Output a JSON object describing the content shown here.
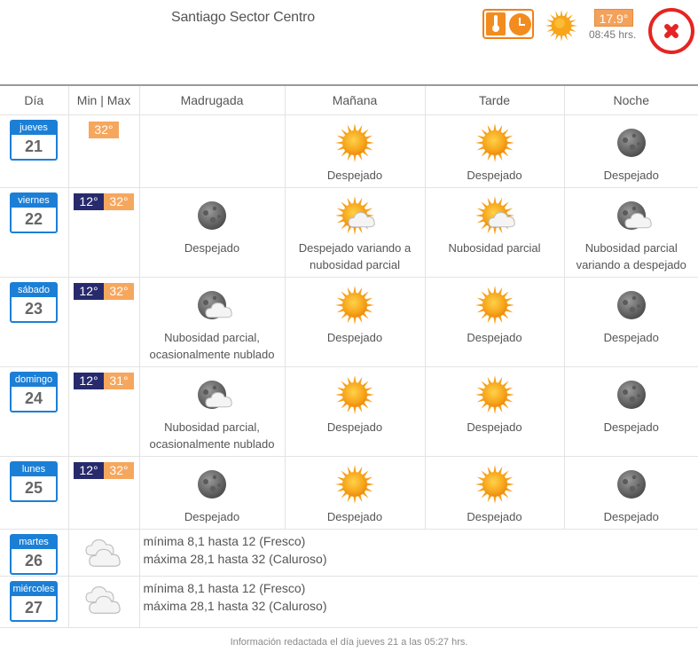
{
  "header": {
    "location": "Santiago Sector Centro",
    "current_temp": "17.9°",
    "current_time": "08:45 hrs.",
    "icons": [
      "thermometer-clock-icon",
      "sun-icon",
      "close-icon"
    ]
  },
  "columns": [
    "Día",
    "Min | Max",
    "Madrugada",
    "Mañana",
    "Tarde",
    "Noche"
  ],
  "days": [
    {
      "name": "jueves",
      "num": "21",
      "min": "",
      "max": "32°",
      "periods": [
        {
          "icon": "",
          "desc": ""
        },
        {
          "icon": "sun",
          "desc": "Despejado"
        },
        {
          "icon": "sun",
          "desc": "Despejado"
        },
        {
          "icon": "moon",
          "desc": "Despejado"
        }
      ]
    },
    {
      "name": "viernes",
      "num": "22",
      "min": "12°",
      "max": "32°",
      "periods": [
        {
          "icon": "moon",
          "desc": "Despejado"
        },
        {
          "icon": "sun-cloud",
          "desc": "Despejado variando a nubosidad parcial"
        },
        {
          "icon": "sun-cloud",
          "desc": "Nubosidad parcial"
        },
        {
          "icon": "moon-cloud",
          "desc": "Nubosidad parcial variando a despejado"
        }
      ]
    },
    {
      "name": "sábado",
      "num": "23",
      "min": "12°",
      "max": "32°",
      "periods": [
        {
          "icon": "moon-cloud",
          "desc": "Nubosidad parcial, ocasionalmente nublado"
        },
        {
          "icon": "sun",
          "desc": "Despejado"
        },
        {
          "icon": "sun",
          "desc": "Despejado"
        },
        {
          "icon": "moon",
          "desc": "Despejado"
        }
      ]
    },
    {
      "name": "domingo",
      "num": "24",
      "min": "12°",
      "max": "31°",
      "periods": [
        {
          "icon": "moon-cloud",
          "desc": "Nubosidad parcial, ocasionalmente nublado"
        },
        {
          "icon": "sun",
          "desc": "Despejado"
        },
        {
          "icon": "sun",
          "desc": "Despejado"
        },
        {
          "icon": "moon",
          "desc": "Despejado"
        }
      ]
    },
    {
      "name": "lunes",
      "num": "25",
      "min": "12°",
      "max": "32°",
      "periods": [
        {
          "icon": "moon",
          "desc": "Despejado"
        },
        {
          "icon": "sun",
          "desc": "Despejado"
        },
        {
          "icon": "sun",
          "desc": "Despejado"
        },
        {
          "icon": "moon",
          "desc": "Despejado"
        }
      ]
    }
  ],
  "extended": [
    {
      "name": "martes",
      "num": "26",
      "icon": "clouds",
      "line1": "mínima 8,1 hasta 12 (Fresco)",
      "line2": "máxima 28,1 hasta 32 (Caluroso)"
    },
    {
      "name": "miércoles",
      "num": "27",
      "icon": "clouds",
      "line1": "mínima 8,1 hasta 12 (Fresco)",
      "line2": "máxima 28,1 hasta 32 (Caluroso)"
    }
  ],
  "footer": "Información redactada el día jueves 21 a las 05:27 hrs.",
  "colors": {
    "accent_blue": "#1c7fd6",
    "min_bg": "#272a6c",
    "max_bg": "#f6a75e",
    "sun": "#f5a11c",
    "close_red": "#e52521"
  }
}
